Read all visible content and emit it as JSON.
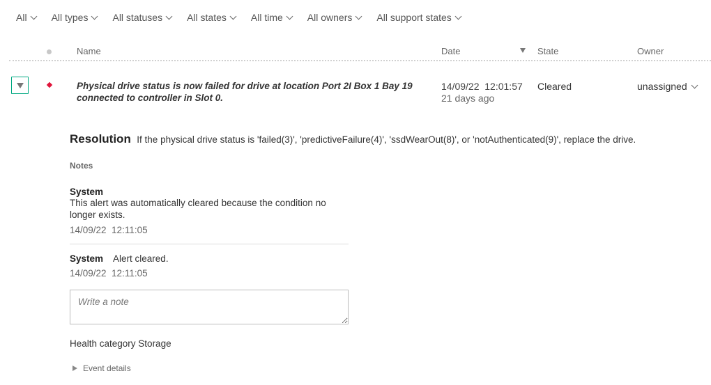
{
  "filters": [
    {
      "label": "All"
    },
    {
      "label": "All types"
    },
    {
      "label": "All statuses"
    },
    {
      "label": "All states"
    },
    {
      "label": "All time"
    },
    {
      "label": "All owners"
    },
    {
      "label": "All support states"
    }
  ],
  "table": {
    "columns": {
      "name": "Name",
      "date": "Date",
      "state": "State",
      "owner": "Owner"
    }
  },
  "alert": {
    "severity_color": "#e0163c",
    "name": "Physical drive status is now failed for drive at location Port 2I Box 1 Bay 19 connected to controller in Slot 0.",
    "date": "14/09/22  12:01:57",
    "relative": "21 days ago",
    "state": "Cleared",
    "owner": "unassigned"
  },
  "detail": {
    "resolution_label": "Resolution",
    "resolution_text": "If the physical drive status is 'failed(3)', 'predictiveFailure(4)', 'ssdWearOut(8)', or 'notAuthenticated(9)', replace the drive.",
    "notes_label": "Notes",
    "notes": [
      {
        "author": "System",
        "text": "This alert was automatically cleared because the condition no longer exists.",
        "time": "14/09/22  12:11:05"
      },
      {
        "author": "System",
        "text": "Alert cleared.",
        "time": "14/09/22  12:11:05"
      }
    ],
    "note_placeholder": "Write a note",
    "health_category": "Health category Storage",
    "event_details": "Event details"
  },
  "colors": {
    "accent": "#01a982",
    "critical": "#e0163c"
  }
}
